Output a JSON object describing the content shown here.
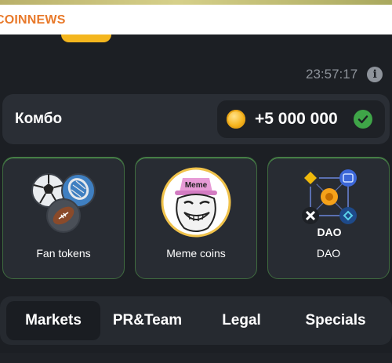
{
  "brand": {
    "name": "COINNEWS",
    "color": "#e8792a"
  },
  "timer": {
    "text": "23:57:17",
    "info_icon": "info-icon"
  },
  "combo": {
    "label": "Комбо",
    "amount": "+5 000 000",
    "coin_icon": "coin-icon",
    "status_icon": "check-icon",
    "status_color": "#3fa548"
  },
  "categories": [
    {
      "label": "Fan tokens",
      "icon": "sports-balls-icon"
    },
    {
      "label": "Meme coins",
      "icon": "troll-face-meme-icon",
      "icon_text": "Meme"
    },
    {
      "label": "DAO",
      "icon": "dao-network-icon",
      "icon_text": "DAO"
    }
  ],
  "tabs": [
    {
      "label": "Markets",
      "active": true
    },
    {
      "label": "PR&Team",
      "active": false
    },
    {
      "label": "Legal",
      "active": false
    },
    {
      "label": "Specials",
      "active": false
    }
  ],
  "colors": {
    "background": "#1c1f24",
    "card": "#2a2e35",
    "accent_green": "#4e9a4e"
  }
}
